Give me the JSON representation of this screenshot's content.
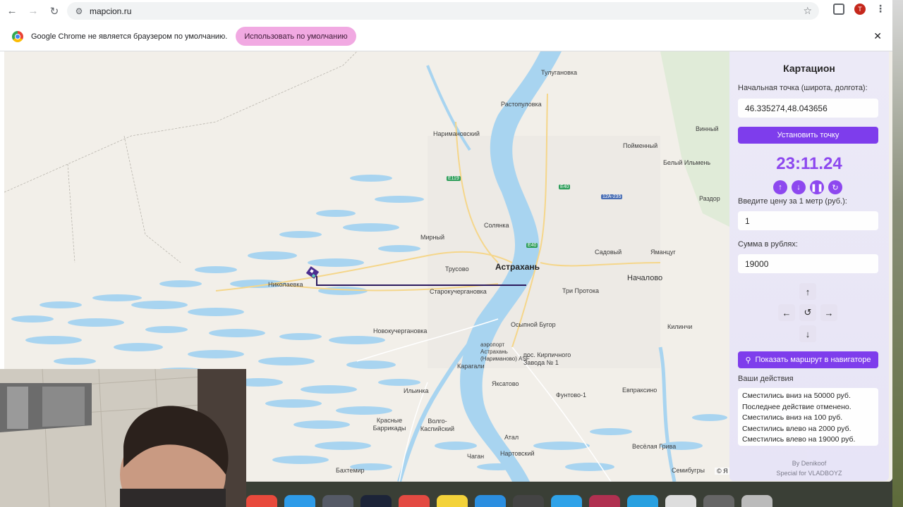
{
  "browser": {
    "url": "mapcion.ru",
    "profile_initial": "T"
  },
  "infobar": {
    "message": "Google Chrome не является браузером по умолчанию.",
    "button_label": "Использовать по умолчанию"
  },
  "map": {
    "labels": {
      "tulyganovka": "Тулугановка",
      "rastopulovka": "Растопуловка",
      "narimanovskiy": "Наримановский",
      "solyanka": "Солянка",
      "mirny": "Мирный",
      "astrakhan": "Астрахань",
      "trusovo": "Трусово",
      "nikolaevka": "Николаевка",
      "starokucherganovka": "Старокучергановка",
      "tri_protoka": "Три Протока",
      "nachalovo": "Началово",
      "sadovy": "Садовый",
      "yamantsug": "Яманцуг",
      "beliy_ilmen": "Белый Ильмень",
      "poymenny": "Пойменный",
      "vinny": "Винный",
      "razdor": "Раздор",
      "novokucherganovka": "Новокучергановка",
      "osypnoy_bugor": "Осыпной Бугор",
      "airport": "аэропорт Астрахань (Нариманово) ASF",
      "karagali": "Карагали",
      "kirpichnogo": "пос. Кирпичного Завода № 1",
      "kilinchi": "Килинчи",
      "ilyinka": "Ильинка",
      "yaksatovo": "Яксатово",
      "funtovo": "Фунтово-1",
      "evpraksino": "Евпраксино",
      "krasnye_barrikady": "Красные Баррикады",
      "volgo_kaspiysky": "Волго-Каспийский",
      "atal": "Атал",
      "nartovsky": "Нартовский",
      "chagan": "Чаган",
      "bakhtemir": "Бахтемир",
      "veselaya_griva": "Весёлая Грива",
      "semibugry": "Семибугры",
      "copyright": "© Я"
    },
    "shields": {
      "e119": "E119",
      "e40a": "E40",
      "e40b": "E40",
      "r12a": "12A-235"
    }
  },
  "panel": {
    "title": "Картацион",
    "start_label": "Начальная точка (широта, долгота):",
    "start_value": "46.335274,48.043656",
    "set_point_label": "Установить точку",
    "timer": "23:11.24",
    "price_label": "Введите цену за 1 метр (руб.):",
    "price_value": "1",
    "sum_label": "Сумма в рублях:",
    "sum_value": "19000",
    "route_button": "Показать маршрут в навигаторе",
    "actions_label": "Ваши действия",
    "actions": [
      "Сместились вниз на 50000 руб.",
      "Последнее действие отменено.",
      "Сместились вниз на 100 руб.",
      "Сместились влево на 2000 руб.",
      "Сместились влево на 19000 руб."
    ],
    "footer_by": "By Denikoof",
    "footer_special": "Special for VLADBOYZ"
  },
  "colors": {
    "accent": "#7c3aed",
    "timer": "#8b45f0",
    "infobar_button": "#f1a9e2",
    "water": "#a8d4f0",
    "route": "#2b1a5e"
  }
}
